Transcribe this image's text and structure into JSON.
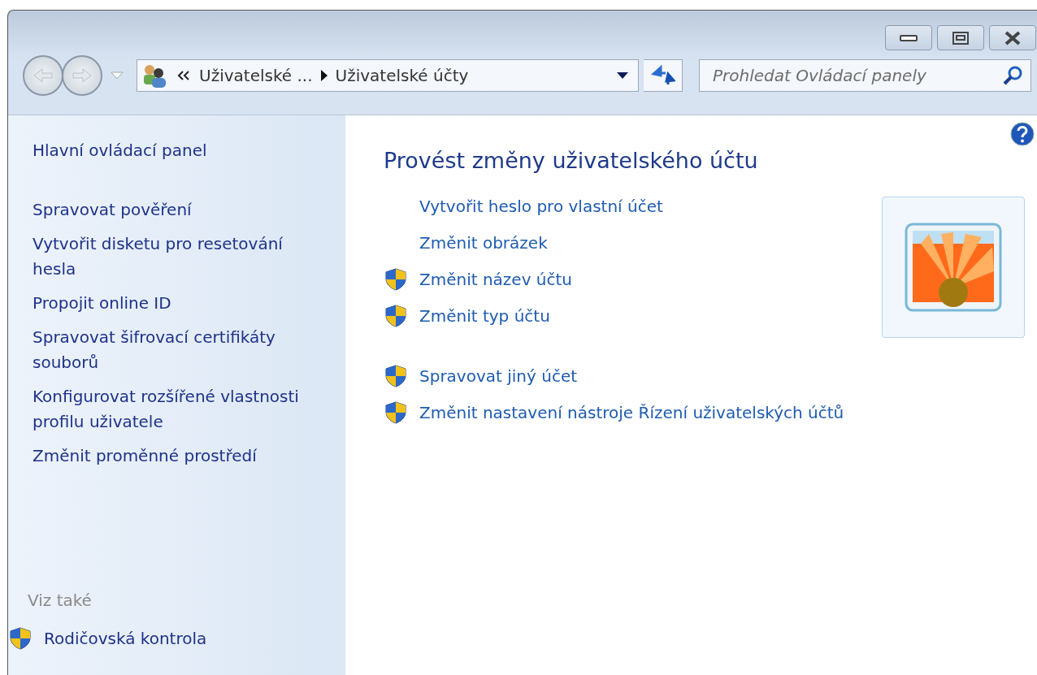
{
  "address_bar": {
    "crumbs": [
      "Uživatelské ...",
      "Uživatelské účty"
    ]
  },
  "search": {
    "placeholder": "Prohledat Ovládací panely"
  },
  "sidebar": {
    "items": [
      {
        "label": "Hlavní ovládací panel",
        "shield": false
      },
      {
        "label": "Spravovat pověření",
        "shield": false
      },
      {
        "label": "Vytvořit disketu pro resetování hesla",
        "shield": false
      },
      {
        "label": "Propojit online ID",
        "shield": false
      },
      {
        "label": "Spravovat šifrovací certifikáty souborů",
        "shield": false
      },
      {
        "label": "Konfigurovat rozšířené vlastnosti profilu uživatele",
        "shield": false
      },
      {
        "label": "Změnit proměnné prostředí",
        "shield": false
      }
    ],
    "see_also": {
      "heading": "Viz také",
      "items": [
        {
          "label": "Rodičovská kontrola",
          "shield": true
        }
      ]
    }
  },
  "main": {
    "title": "Provést změny uživatelského účtu",
    "link_groups": [
      [
        {
          "label": "Vytvořit heslo pro vlastní účet",
          "shield": false
        },
        {
          "label": "Změnit obrázek",
          "shield": false
        },
        {
          "label": "Změnit název účtu",
          "shield": true
        },
        {
          "label": "Změnit typ účtu",
          "shield": true
        }
      ],
      [
        {
          "label": "Spravovat jiný účet",
          "shield": true
        },
        {
          "label": "Změnit nastavení nástroje Řízení uživatelských účtů",
          "shield": true
        }
      ]
    ]
  }
}
